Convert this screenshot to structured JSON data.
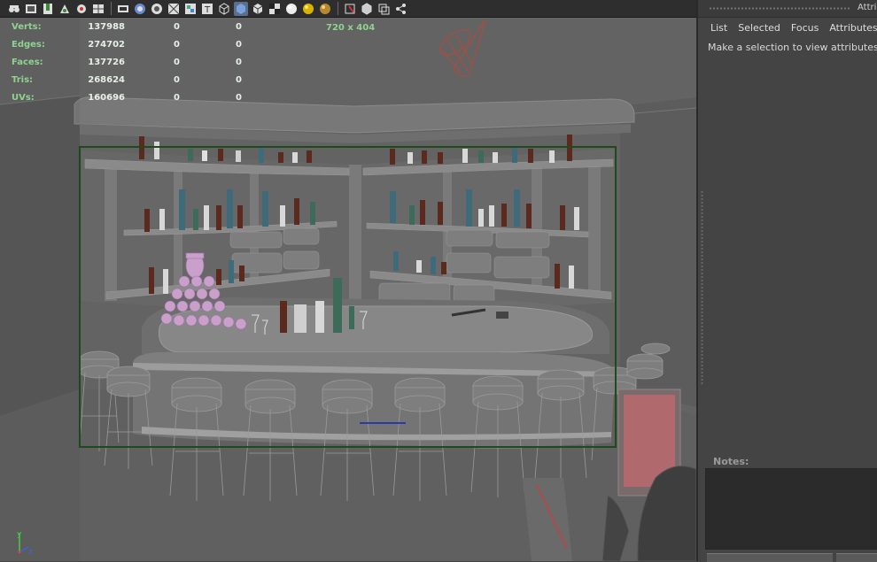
{
  "toolbar": {
    "buttons": [
      "camera-attributes-icon",
      "image-plane-icon",
      "bookmark-icon",
      "2d-pan-zoom-icon",
      "grease-pencil-icon",
      "grid-icon",
      "film-gate-icon",
      "resolution-gate-icon",
      "gate-mask-icon",
      "field-chart-icon",
      "safe-action-icon",
      "safe-title-icon",
      "wireframe-icon",
      "smooth-shade-icon",
      "wireframe-on-shaded-icon",
      "textured-icon",
      "use-all-lights-icon",
      "shadows-icon",
      "screen-space-ao-icon",
      "isolate-select-icon",
      "xray-icon",
      "xray-active-components-icon",
      "xray-joints-icon"
    ]
  },
  "hud": {
    "rows": [
      {
        "label": "Verts:",
        "v1": "137988",
        "v2": "0",
        "v3": "0"
      },
      {
        "label": "Edges:",
        "v1": "274702",
        "v2": "0",
        "v3": "0"
      },
      {
        "label": "Faces:",
        "v1": "137726",
        "v2": "0",
        "v3": "0"
      },
      {
        "label": "Tris:",
        "v1": "268624",
        "v2": "0",
        "v3": "0"
      },
      {
        "label": "UVs:",
        "v1": "160696",
        "v2": "0",
        "v3": "0"
      }
    ],
    "resolution": "720 x 404"
  },
  "axis": {
    "y": "y",
    "z": "z"
  },
  "panel": {
    "title": "Attrib",
    "menu": [
      "List",
      "Selected",
      "Focus",
      "Attributes"
    ],
    "message": "Make a selection to view attributes",
    "notes_label": "Notes:",
    "notes_value": ""
  },
  "colors": {
    "viewport_bg": "#636363",
    "hud_label": "#8fd28f",
    "resolution_gate": "#2c5a2c",
    "panel_bg": "#444444"
  }
}
